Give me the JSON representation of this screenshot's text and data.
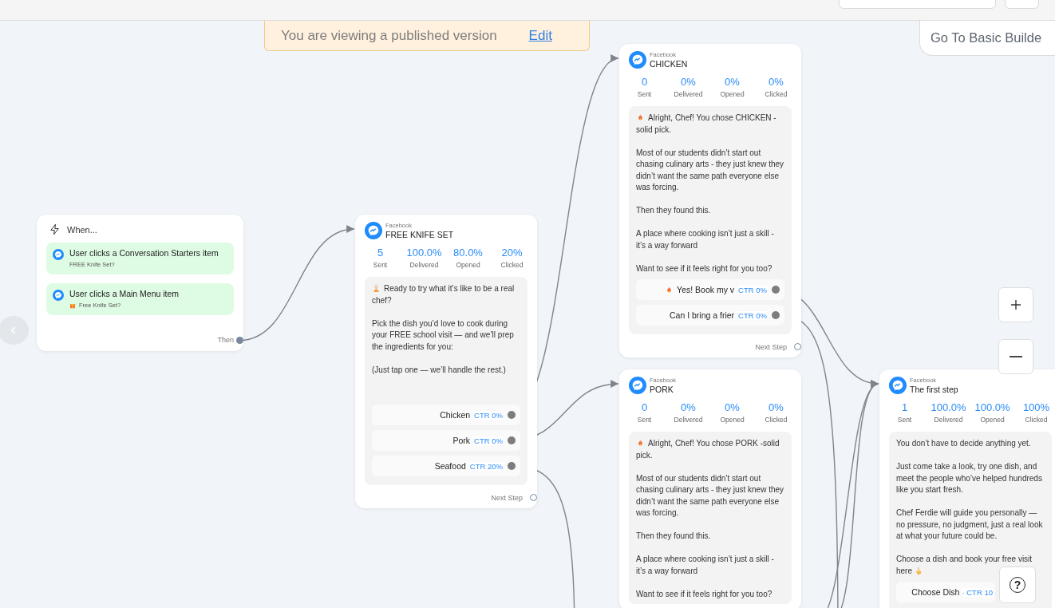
{
  "banner": {
    "text": "You are viewing a published version",
    "link": "Edit"
  },
  "basic_builder_button": "Go To Basic Builde",
  "nodes": [
    {
      "kind": "trigger",
      "title": "When...",
      "triggers": [
        {
          "text": "User clicks a Conversation Starters item",
          "detail": "FREE Knife Set?"
        },
        {
          "text": "User clicks a Main Menu item",
          "detail": "Free Knife Set?"
        }
      ],
      "handle_label": "Then"
    },
    {
      "kind": "message",
      "channel": "Facebook",
      "title": "FREE KNIFE SET",
      "stats": [
        {
          "value": "5",
          "label": "Sent"
        },
        {
          "value": "100.0%",
          "label": "Delivered"
        },
        {
          "value": "80.0%",
          "label": "Opened"
        },
        {
          "value": "20%",
          "label": "Clicked"
        }
      ],
      "paragraphs": [
        "Ready to try what it’s like to be a real chef?",
        "Pick the dish you’d love to cook during your FREE school visit — and we’ll prep the ingredients for you:",
        "(Just tap one — we’ll handle the rest.)"
      ],
      "buttons": [
        {
          "label": "Chicken",
          "ctr": "CTR 0%"
        },
        {
          "label": "Pork",
          "ctr": "CTR 0%"
        },
        {
          "label": "Seafood",
          "ctr": "CTR 20%"
        }
      ],
      "next_label": "Next Step"
    },
    {
      "kind": "message",
      "channel": "Facebook",
      "title": "CHICKEN",
      "stats": [
        {
          "value": "0",
          "label": "Sent"
        },
        {
          "value": "0%",
          "label": "Delivered"
        },
        {
          "value": "0%",
          "label": "Opened"
        },
        {
          "value": "0%",
          "label": "Clicked"
        }
      ],
      "paragraphs": [
        "Alright, Chef! You chose CHICKEN -solid pick.",
        "Most of our students didn’t start out chasing culinary arts - they just knew they didn’t want the same path everyone else was forcing.",
        "Then they found this.",
        "A place where cooking isn’t just a skill - it’s a way forward",
        "Want to see if it feels right for you too?"
      ],
      "buttons": [
        {
          "label": "Yes! Book my v",
          "ctr": "CTR 0%"
        },
        {
          "label": "Can I bring a frier",
          "ctr": "CTR 0%"
        }
      ],
      "next_label": "Next Step"
    },
    {
      "kind": "message",
      "channel": "Facebook",
      "title": "PORK",
      "stats": [
        {
          "value": "0",
          "label": "Sent"
        },
        {
          "value": "0%",
          "label": "Delivered"
        },
        {
          "value": "0%",
          "label": "Opened"
        },
        {
          "value": "0%",
          "label": "Clicked"
        }
      ],
      "paragraphs": [
        "Alright, Chef! You chose PORK -solid pick.",
        "Most of our students didn’t start out chasing culinary arts - they just knew they didn’t want the same path everyone else was forcing.",
        "Then they found this.",
        "A place where cooking isn’t just a skill - it’s a way forward",
        "Want to see if it feels right for you too?"
      ]
    },
    {
      "kind": "message",
      "channel": "Facebook",
      "title": "The first step",
      "stats": [
        {
          "value": "1",
          "label": "Sent"
        },
        {
          "value": "100.0%",
          "label": "Delivered"
        },
        {
          "value": "100.0%",
          "label": "Opened"
        },
        {
          "value": "100%",
          "label": "Clicked"
        }
      ],
      "paragraphs": [
        "You don’t have to decide anything yet.",
        "Just come take a look, try one dish, and meet the people who’ve helped hundreds like you start fresh.",
        "Chef Ferdie will guide you personally — no pressure, no judgment, just a real look at what your future could be.",
        "Choose a dish and book your free visit here"
      ],
      "buttons": [
        {
          "label": "Choose Dish",
          "ctr": "· CTR 10"
        }
      ]
    }
  ],
  "help_button": "?"
}
